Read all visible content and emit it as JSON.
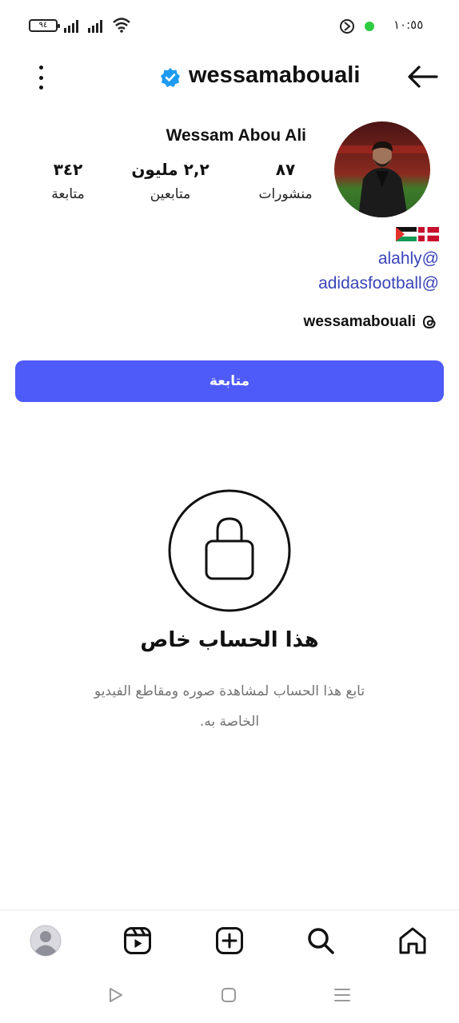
{
  "status_bar": {
    "battery": "٩٤",
    "time": "١٠:٥٥",
    "icons": [
      "battery-icon",
      "signal-icon",
      "signal-icon",
      "wifi-icon",
      "alarm-icon",
      "whatsapp-dot-icon"
    ]
  },
  "header": {
    "username": "wessamabouali",
    "icons": [
      "more-options-icon",
      "verified-badge-icon",
      "back-arrow-icon"
    ]
  },
  "profile": {
    "display_name": "Wessam Abou Ali",
    "stats": {
      "posts": {
        "value": "٨٧",
        "label": "منشورات"
      },
      "followers": {
        "value": "٢,٢ مليون",
        "label": "متابعين"
      },
      "following": {
        "value": "٣٤٢",
        "label": "متابعة"
      }
    },
    "flags": [
      "palestine-flag-icon",
      "denmark-flag-icon"
    ],
    "bio_links": [
      "alahly@",
      "adidasfootball@"
    ],
    "threads": {
      "name": "wessamabouali",
      "icon": "threads-icon"
    }
  },
  "follow_button": {
    "label": "متابعة"
  },
  "private_notice": {
    "title": "هذا الحساب خاص",
    "subtitle": "تابع هذا الحساب لمشاهدة صوره ومقاطع الفيديو الخاصة به.",
    "icon": "lock-icon"
  },
  "bottom_nav": {
    "items": [
      "profile-avatar-icon",
      "reels-icon",
      "create-post-icon",
      "search-icon",
      "home-icon"
    ]
  },
  "system_nav": {
    "items": [
      "back-triangle-icon",
      "home-square-icon",
      "recents-menu-icon"
    ]
  },
  "colors": {
    "accent": "#4f5bf8",
    "link": "#3a44b8",
    "verified": "#1d9bf0",
    "muted_text": "#737373"
  }
}
